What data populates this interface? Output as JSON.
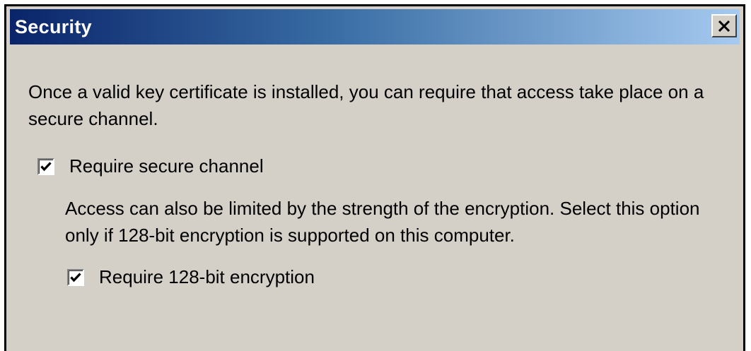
{
  "window": {
    "title": "Security"
  },
  "titlebar": {
    "close_icon": "close-icon",
    "colors": {
      "gradient_start": "#0a246a",
      "gradient_end": "#a6caf0"
    }
  },
  "content": {
    "intro_text": "Once a valid key certificate is installed, you can require that access take place on a secure channel.",
    "secure_channel": {
      "label": "Require secure channel",
      "checked": true
    },
    "encryption_note": "Access can also be limited by the strength of the encryption. Select this option only if 128-bit encryption is supported on this computer.",
    "encryption_128": {
      "label": "Require 128-bit encryption",
      "checked": true
    }
  },
  "colors": {
    "dialog_background": "#d4d0c8",
    "title_text": "#ffffff"
  }
}
